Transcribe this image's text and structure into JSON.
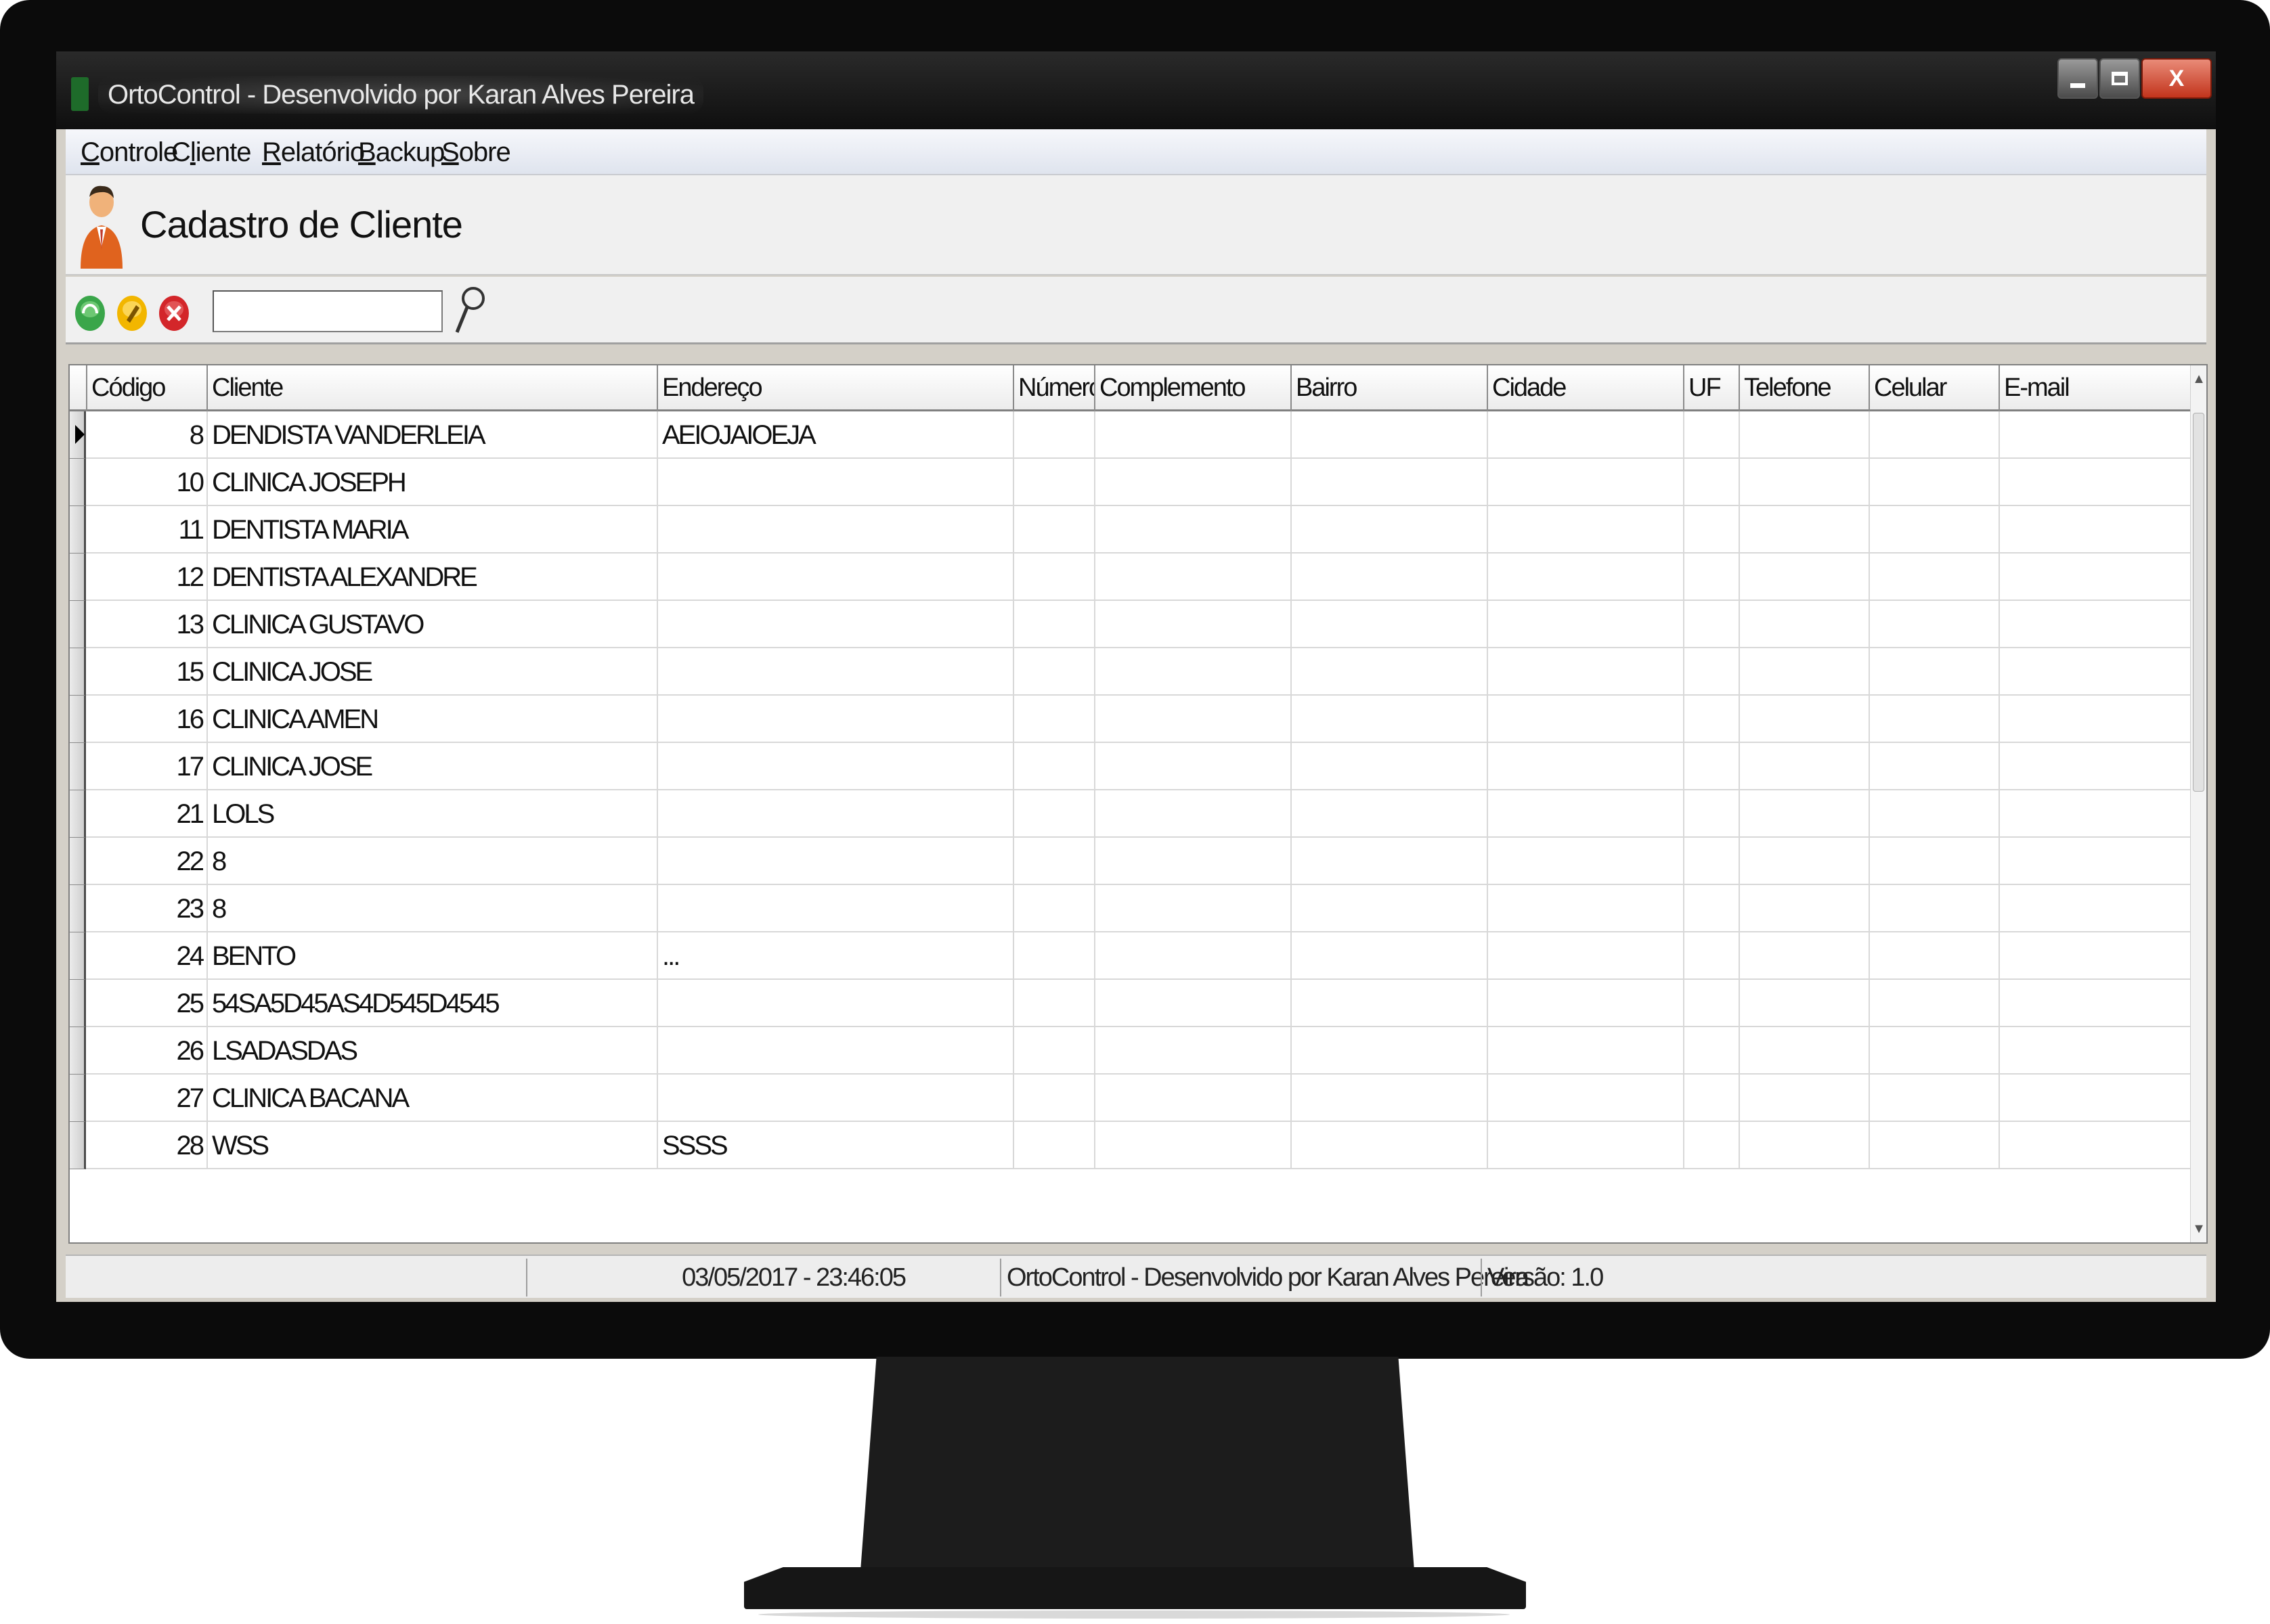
{
  "window": {
    "title": "OrtoControl - Desenvolvido por Karan Alves Pereira",
    "controls": {
      "minimize": "",
      "maximize": "",
      "close": "X"
    }
  },
  "menu": [
    {
      "first": "C",
      "rest": "ontrole"
    },
    {
      "first": "",
      "pre": "C",
      "ul": "l",
      "rest": "iente"
    },
    {
      "first": "R",
      "rest": "elatório"
    },
    {
      "first": "B",
      "rest": "ackup"
    },
    {
      "first": "S",
      "rest": "obre"
    }
  ],
  "header": {
    "title": "Cadastro de Cliente",
    "icon": "user-icon"
  },
  "toolbar": {
    "icons": [
      "add-icon",
      "edit-icon",
      "delete-icon",
      "search-icon"
    ],
    "search_value": ""
  },
  "grid": {
    "columns": [
      "Código",
      "Cliente",
      "Endereço",
      "Número",
      "Complemento",
      "Bairro",
      "Cidade",
      "UF",
      "Telefone",
      "Celular",
      "E-mail"
    ],
    "selected_row": 0,
    "rows": [
      {
        "codigo": "8",
        "cliente": "DENDISTA VANDERLEIA",
        "endereco": "AEIOJAIOEJA"
      },
      {
        "codigo": "10",
        "cliente": "CLINICA JOSEPH",
        "endereco": ""
      },
      {
        "codigo": "11",
        "cliente": "DENTISTA MARIA",
        "endereco": ""
      },
      {
        "codigo": "12",
        "cliente": "DENTISTA ALEXANDRE",
        "endereco": ""
      },
      {
        "codigo": "13",
        "cliente": "CLINICA  GUSTAVO",
        "endereco": ""
      },
      {
        "codigo": "15",
        "cliente": "CLINICA JOSE",
        "endereco": ""
      },
      {
        "codigo": "16",
        "cliente": "CLINICA AMEN",
        "endereco": ""
      },
      {
        "codigo": "17",
        "cliente": "CLINICA JOSE",
        "endereco": ""
      },
      {
        "codigo": "21",
        "cliente": "LOLS",
        "endereco": ""
      },
      {
        "codigo": "22",
        "cliente": "8",
        "endereco": ""
      },
      {
        "codigo": "23",
        "cliente": "8",
        "endereco": ""
      },
      {
        "codigo": "24",
        "cliente": "BENTO",
        "endereco": "..."
      },
      {
        "codigo": "25",
        "cliente": "54SA5D45AS4D545D4545",
        "endereco": ""
      },
      {
        "codigo": "26",
        "cliente": "LSADASDAS",
        "endereco": ""
      },
      {
        "codigo": "27",
        "cliente": "CLINICA BACANA",
        "endereco": ""
      },
      {
        "codigo": "28",
        "cliente": "WSS",
        "endereco": "SSSS"
      }
    ]
  },
  "status": {
    "panel1": "",
    "datetime": "03/05/2017 - 23:46:05",
    "app": "OrtoControl - Desenvolvido por Karan Alves Pereira",
    "version": "Versão: 1.0"
  },
  "colors": {
    "close_button": "#c2341c",
    "title_bar": "#0f0f0f",
    "bezel": "#0b0b0b"
  }
}
